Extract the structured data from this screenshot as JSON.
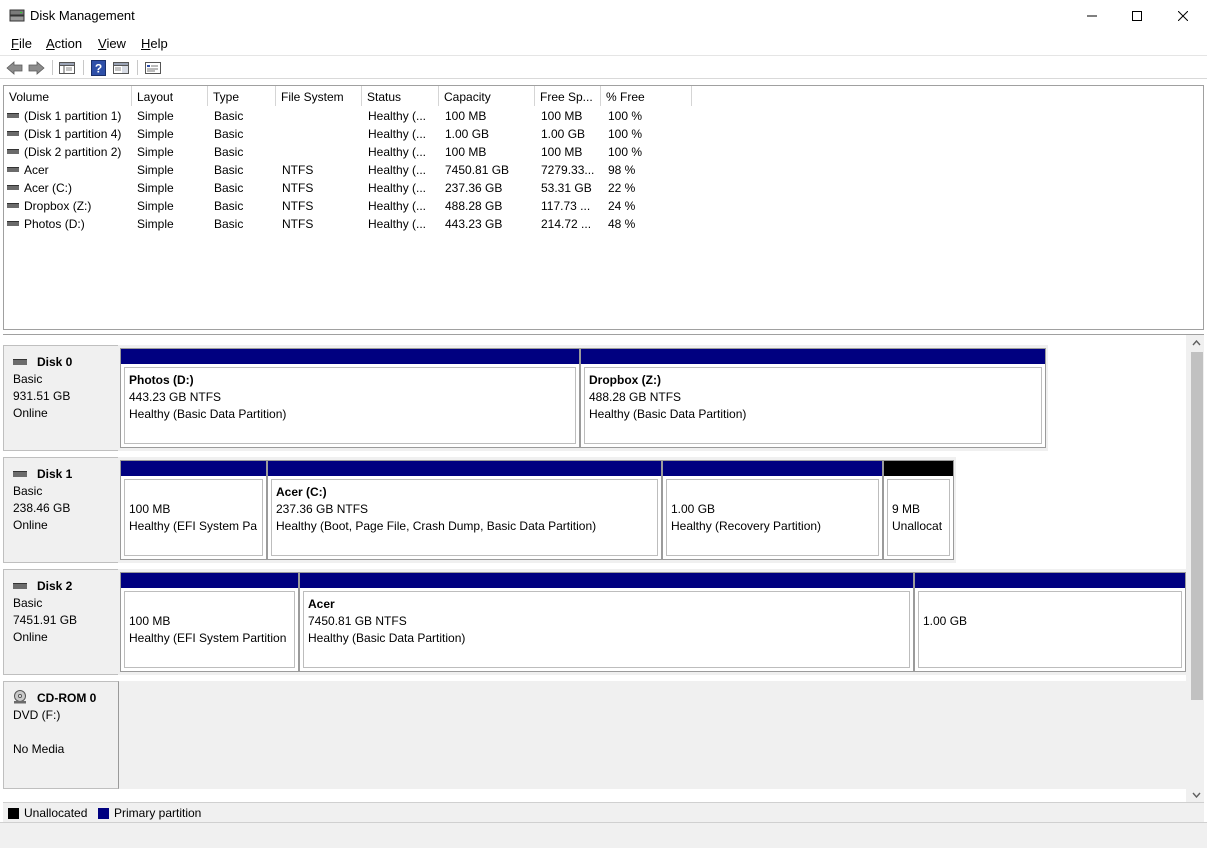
{
  "window": {
    "title": "Disk Management",
    "controls": [
      "minimize",
      "maximize",
      "close"
    ]
  },
  "menu": [
    {
      "label": "File",
      "accel": "F",
      "rest": "ile"
    },
    {
      "label": "Action",
      "accel": "A",
      "rest": "ction"
    },
    {
      "label": "View",
      "accel": "V",
      "rest": "iew"
    },
    {
      "label": "Help",
      "accel": "H",
      "rest": "elp"
    }
  ],
  "toolbar": {
    "buttons": [
      "back-arrow-icon",
      "forward-arrow-icon",
      "console-tree-icon",
      "help-icon",
      "show-pane-icon",
      "properties-icon"
    ]
  },
  "volume_list": {
    "columns": [
      "Volume",
      "Layout",
      "Type",
      "File System",
      "Status",
      "Capacity",
      "Free Sp...",
      "% Free"
    ],
    "rows": [
      [
        "(Disk 1 partition 1)",
        "Simple",
        "Basic",
        "",
        "Healthy (...",
        "100 MB",
        "100 MB",
        "100 %"
      ],
      [
        "(Disk 1 partition 4)",
        "Simple",
        "Basic",
        "",
        "Healthy (...",
        "1.00 GB",
        "1.00 GB",
        "100 %"
      ],
      [
        "(Disk 2 partition 2)",
        "Simple",
        "Basic",
        "",
        "Healthy (...",
        "100 MB",
        "100 MB",
        "100 %"
      ],
      [
        "Acer",
        "Simple",
        "Basic",
        "NTFS",
        "Healthy (...",
        "7450.81 GB",
        "7279.33...",
        "98 %"
      ],
      [
        "Acer (C:)",
        "Simple",
        "Basic",
        "NTFS",
        "Healthy (...",
        "237.36 GB",
        "53.31 GB",
        "22 %"
      ],
      [
        "Dropbox (Z:)",
        "Simple",
        "Basic",
        "NTFS",
        "Healthy (...",
        "488.28 GB",
        "117.73 ...",
        "24 %"
      ],
      [
        "Photos (D:)",
        "Simple",
        "Basic",
        "NTFS",
        "Healthy (...",
        "443.23 GB",
        "214.72 ...",
        "48 %"
      ]
    ]
  },
  "disks": [
    {
      "name": "Disk 0",
      "type": "Basic",
      "size": "931.51 GB",
      "state": "Online",
      "partitions": [
        {
          "name": "Photos  (D:)",
          "line1": "443.23 GB NTFS",
          "line2": "Healthy (Basic Data Partition)",
          "kind": "primary"
        },
        {
          "name": "Dropbox  (Z:)",
          "line1": "488.28 GB NTFS",
          "line2": "Healthy (Basic Data Partition)",
          "kind": "primary"
        }
      ]
    },
    {
      "name": "Disk 1",
      "type": "Basic",
      "size": "238.46 GB",
      "state": "Online",
      "partitions": [
        {
          "name": "",
          "line1": "100 MB",
          "line2": "Healthy (EFI System Pa",
          "kind": "primary"
        },
        {
          "name": "Acer  (C:)",
          "line1": "237.36 GB NTFS",
          "line2": "Healthy (Boot, Page File, Crash Dump, Basic Data Partition)",
          "kind": "primary"
        },
        {
          "name": "",
          "line1": "1.00 GB",
          "line2": "Healthy (Recovery Partition)",
          "kind": "primary"
        },
        {
          "name": "",
          "line1": "9 MB",
          "line2": "Unallocat",
          "kind": "unallocated"
        }
      ]
    },
    {
      "name": "Disk 2",
      "type": "Basic",
      "size": "7451.91 GB",
      "state": "Online",
      "partitions": [
        {
          "name": "",
          "line1": "100 MB",
          "line2": "Healthy (EFI System Partition",
          "kind": "primary"
        },
        {
          "name": "Acer",
          "line1": "7450.81 GB NTFS",
          "line2": "Healthy (Basic Data Partition)",
          "kind": "primary"
        },
        {
          "name": "",
          "line1": "1.00 GB",
          "line2": "",
          "kind": "primary"
        }
      ]
    },
    {
      "name": "CD-ROM 0",
      "type": "DVD (F:)",
      "size": "",
      "state": "No Media",
      "partitions": []
    }
  ],
  "legend": [
    {
      "label": "Unallocated",
      "color": "#000000"
    },
    {
      "label": "Primary partition",
      "color": "#000080"
    }
  ],
  "colors": {
    "primary_bar": "#000080",
    "unallocated_bar": "#000000"
  }
}
